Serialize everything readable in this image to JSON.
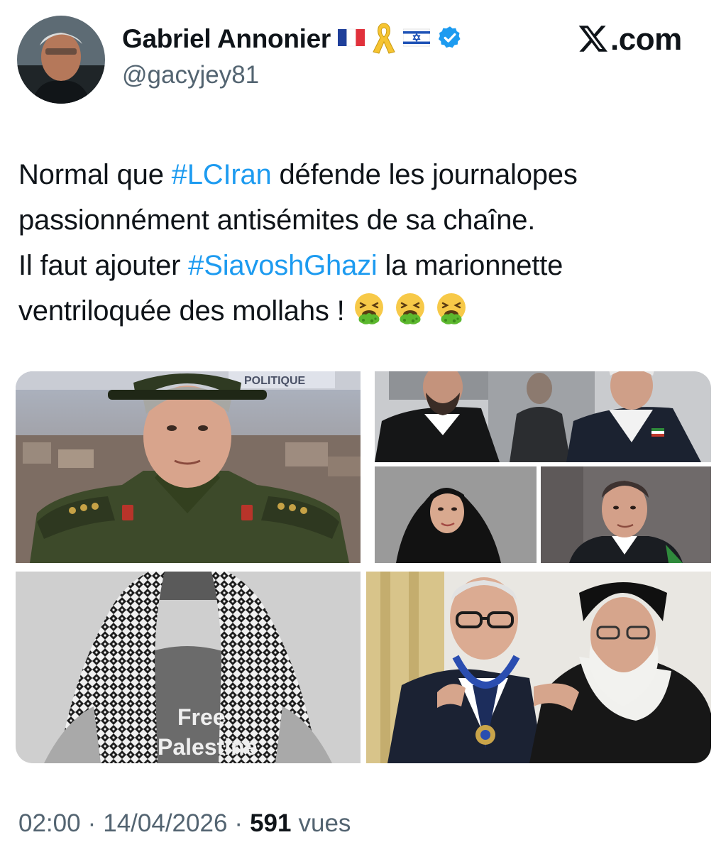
{
  "author": {
    "display_name": "Gabriel Annonier",
    "handle": "@gacyjey81",
    "badges": [
      "france-flag-icon",
      "yellow-ribbon-icon",
      "israel-flag-icon",
      "verified-badge-icon"
    ],
    "verified_color": "#1d9bf0"
  },
  "brand": {
    "logo_icon": "x-logo-icon",
    "suffix": ".com"
  },
  "tweet": {
    "line1": {
      "before": "Normal que ",
      "hashtag": "#LCIran",
      "after": " défende les journalopes"
    },
    "line2": "passionnément antisémites de sa chaîne.",
    "line3": {
      "before": "Il faut ajouter ",
      "hashtag": "#SiavoshGhazi",
      "after": " la marionnette"
    },
    "line4": "ventriloquée des mollahs !",
    "emojis": [
      "vomiting-face-icon",
      "vomiting-face-icon",
      "vomiting-face-icon"
    ],
    "hashtag_color": "#1d9bf0"
  },
  "media": {
    "tiles": [
      {
        "name": "photo-military-officer",
        "banner_text": "POLITIQUE"
      },
      {
        "name": "photo-officials-group"
      },
      {
        "name": "photo-woman-hijab"
      },
      {
        "name": "photo-man-suit"
      },
      {
        "name": "photo-keffiyeh-shirt",
        "shirt_line1": "Free",
        "shirt_line2": "Palestine"
      },
      {
        "name": "photo-medal-ceremony"
      }
    ]
  },
  "meta": {
    "time": "02:00",
    "sep1": "·",
    "date": "14/04/2026",
    "sep2": "·",
    "views_count": "591",
    "views_label": "vues"
  }
}
